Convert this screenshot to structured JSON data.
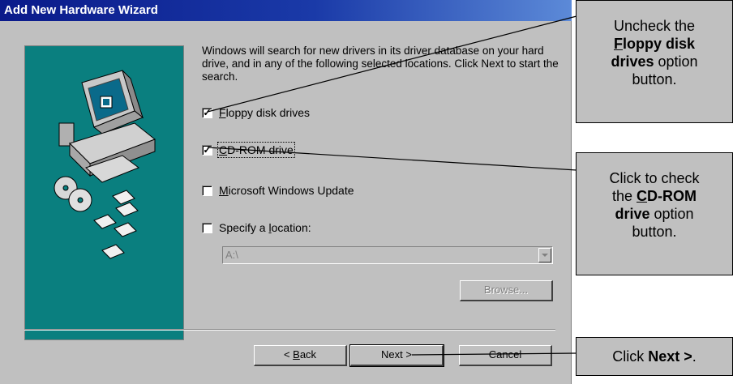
{
  "dialog": {
    "title": "Add New Hardware Wizard",
    "intro_text": "Windows will search for new drivers in its driver database on your hard drive, and in any of the following selected locations. Click Next to start the search.",
    "options": [
      {
        "label_pre": "",
        "label_mnemonic": "F",
        "label_post": "loppy disk drives",
        "checked": true
      },
      {
        "label_pre": "",
        "label_mnemonic": "C",
        "label_post": "D-ROM drive",
        "checked": true
      },
      {
        "label_pre": "",
        "label_mnemonic": "M",
        "label_post": "icrosoft Windows Update",
        "checked": false
      },
      {
        "label_pre": "Specify a ",
        "label_mnemonic": "l",
        "label_post": "ocation:",
        "checked": false
      }
    ],
    "location_value": "A:\\",
    "browse_label": "Browse...",
    "back_mnemonic": "B",
    "back_post": "ack",
    "back_pre": "< ",
    "next_label": "Next >",
    "cancel_label": "Cancel"
  },
  "callouts": {
    "floppy": {
      "t1": "Uncheck the",
      "t2_mn": "F",
      "t2_rest": "loppy disk",
      "t3_bold": "drives",
      "t3_rest": " option",
      "t4": "button."
    },
    "cdrom": {
      "t1": "Click to check",
      "t2_pre": "the ",
      "t2_mn": "C",
      "t2_rest": "D-ROM",
      "t3_bold": "drive",
      "t3_rest": " option",
      "t4": "button."
    },
    "next": {
      "pre": "Click ",
      "bold": "Next >",
      "post": "."
    }
  },
  "colors": {
    "titlebar": "#0a1a8a",
    "dialog_bg": "#c0c0c0",
    "art_bg": "#0a7f7f"
  }
}
